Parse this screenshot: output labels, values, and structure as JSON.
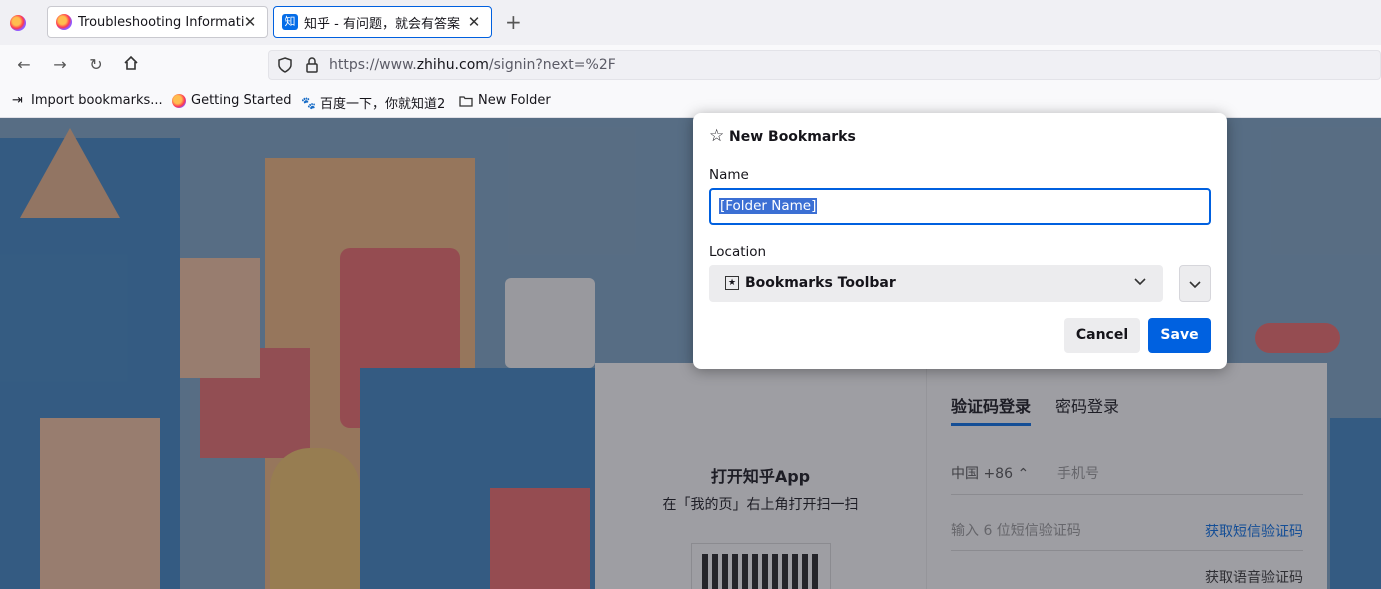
{
  "tabs": [
    {
      "label": "Troubleshooting Informati",
      "icon": "firefox-icon"
    },
    {
      "label": "知乎 - 有问题，就会有答案",
      "icon": "zhihu-icon",
      "badge": "知"
    }
  ],
  "urlbar": {
    "url_prefix": "https://www.",
    "url_domain": "zhihu.com",
    "url_suffix": "/signin?next=%2F"
  },
  "bookmarks": [
    {
      "label": "Import bookmarks..."
    },
    {
      "label": "Getting Started"
    },
    {
      "label": "百度一下，你就知道2"
    },
    {
      "label": "New Folder"
    }
  ],
  "page": {
    "login_tabs": [
      "验证码登录",
      "密码登录"
    ],
    "country_code": "中国 +86",
    "phone_placeholder": "手机号",
    "sms_placeholder": "输入 6 位短信验证码",
    "get_sms_code": "获取短信验证码",
    "get_voice_code": "获取语音验证码",
    "open_app": "打开知乎App",
    "scan_hint": "在「我的页」右上角打开扫一扫"
  },
  "dialog": {
    "title": "New Bookmarks",
    "name_label": "Name",
    "name_value": "[Folder Name]",
    "location_label": "Location",
    "location_value": "Bookmarks Toolbar",
    "cancel_label": "Cancel",
    "save_label": "Save"
  },
  "colors": {
    "accent": "#0061e0",
    "zhihu_blue": "#056de8"
  }
}
